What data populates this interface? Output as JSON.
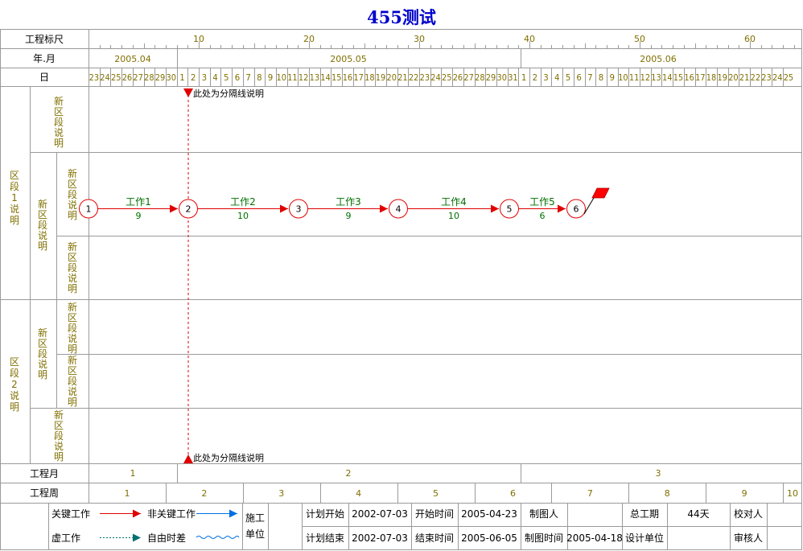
{
  "title": "455测试",
  "header": {
    "ruler_label": "工程标尺",
    "ruler_ticks": [
      "10",
      "20",
      "30",
      "40",
      "50",
      "60"
    ],
    "month_label": "年.月",
    "months": [
      "2005.04",
      "2005.05",
      "2005.06"
    ],
    "day_label": "日",
    "april_days": [
      "23",
      "24",
      "25",
      "26",
      "27",
      "28",
      "29",
      "30"
    ],
    "may_days_count": 31,
    "june_days_count": 25
  },
  "sections": {
    "section1": "区段1说明",
    "section1_sub": "新区段说明",
    "section1_sub_a": "新区段说明",
    "section1_sub_b": "新区段说明",
    "section1_sub_c": "新区段说明",
    "section2": "区段2说明",
    "section2_sub": "新区段说明",
    "section2_sub_a": "新区段说明",
    "section2_sub_b": "新区段说明",
    "section2_sub_c": "新区段说明"
  },
  "separator_note": "此处为分隔线说明",
  "network": {
    "nodes": [
      "1",
      "2",
      "3",
      "4",
      "5",
      "6"
    ],
    "tasks": [
      {
        "name": "工作1",
        "duration": "9"
      },
      {
        "name": "工作2",
        "duration": "10"
      },
      {
        "name": "工作3",
        "duration": "9"
      },
      {
        "name": "工作4",
        "duration": "10"
      },
      {
        "name": "工作5",
        "duration": "6"
      }
    ]
  },
  "footer": {
    "project_month_label": "工程月",
    "project_months": [
      "1",
      "2",
      "3"
    ],
    "project_week_label": "工程周",
    "project_weeks": [
      "1",
      "2",
      "3",
      "4",
      "5",
      "6",
      "7",
      "8",
      "9",
      "10"
    ]
  },
  "legend": {
    "critical": "关键工作",
    "noncritical": "非关键工作",
    "virtual": "虚工作",
    "free_float": "自由时差",
    "unit_line1": "施工",
    "unit_line2": "单位"
  },
  "info": {
    "plan_start_label": "计划开始",
    "plan_start": "2002-07-03",
    "plan_end_label": "计划结束",
    "plan_end": "2002-07-03",
    "start_time_label": "开始时间",
    "start_time": "2005-04-23",
    "end_time_label": "结束时间",
    "end_time": "2005-06-05",
    "drafter_label": "制图人",
    "drafter": "",
    "draw_time_label": "制图时间",
    "draw_time": "2005-04-18",
    "total_label": "总工期",
    "total": "44天",
    "design_unit_label": "设计单位",
    "design_unit": "",
    "checker_label": "校对人",
    "checker": "",
    "reviewer_label": "审核人",
    "reviewer": ""
  },
  "colors": {
    "title": "#0000cc",
    "olive_text": "#807000",
    "critical": "#e00000",
    "noncritical": "#0070e0",
    "free_float": "#007070",
    "task_text": "#007000",
    "grid": "#9a9a9a"
  }
}
